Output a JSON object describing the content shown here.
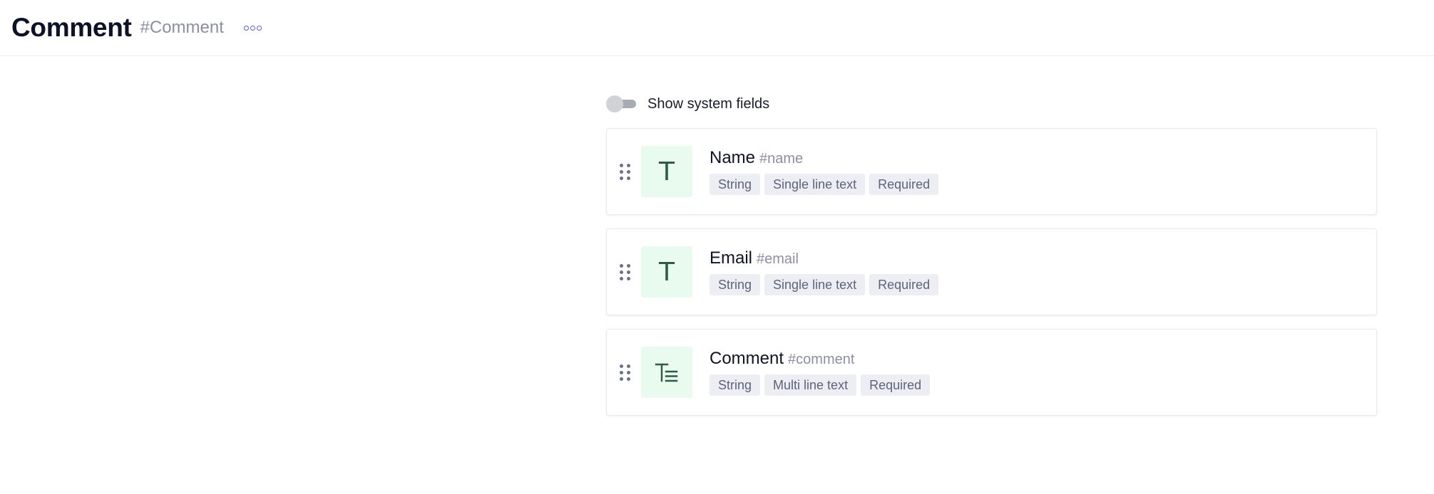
{
  "header": {
    "title": "Comment",
    "api_id": "#Comment",
    "more_icon": "more-horizontal-icon"
  },
  "system_fields_toggle": {
    "label": "Show system fields",
    "checked": false
  },
  "fields": [
    {
      "name": "Name",
      "api_id": "#name",
      "icon": "single-line-text-icon",
      "tags": [
        "String",
        "Single line text",
        "Required"
      ]
    },
    {
      "name": "Email",
      "api_id": "#email",
      "icon": "single-line-text-icon",
      "tags": [
        "String",
        "Single line text",
        "Required"
      ]
    },
    {
      "name": "Comment",
      "api_id": "#comment",
      "icon": "multi-line-text-icon",
      "tags": [
        "String",
        "Multi line text",
        "Required"
      ]
    }
  ],
  "colors": {
    "accent": "#5a5fd6",
    "icon_bg": "#e9faef",
    "icon_fg": "#2f5a49",
    "tag_bg": "#edeef4"
  }
}
